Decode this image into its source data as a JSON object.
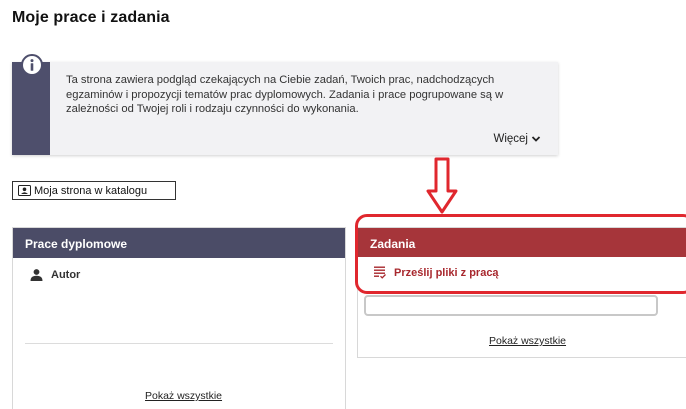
{
  "page": {
    "title": "Moje prace i zadania"
  },
  "info": {
    "icon": "info-icon",
    "text": "Ta strona zawiera podgląd czekających na Ciebie zadań, Twoich prac, nadchodzących egzaminów i propozycji tematów prac dyplomowych. Zadania i prace pogrupowane są w zależności od Twojej roli i rodzaju czynności do wykonania.",
    "more_label": "Więcej",
    "more_icon": "chevron-down-icon"
  },
  "catalog_button": {
    "label": "Moja strona w katalogu",
    "icon": "id-card-icon"
  },
  "theses_panel": {
    "header": "Prace dyplomowe",
    "header_color": "#4b4c67",
    "role_label": "Autor",
    "role_icon": "person-icon",
    "show_all": "Pokaż wszystkie"
  },
  "tasks_panel": {
    "header": "Zadania",
    "header_color": "#a6353a",
    "task_label": "Prześlij pliki z pracą",
    "task_icon": "task-list-icon",
    "show_all": "Pokaż wszystkie"
  },
  "annotation": {
    "color": "#e0272e",
    "arrow_icon": "down-arrow-icon"
  }
}
